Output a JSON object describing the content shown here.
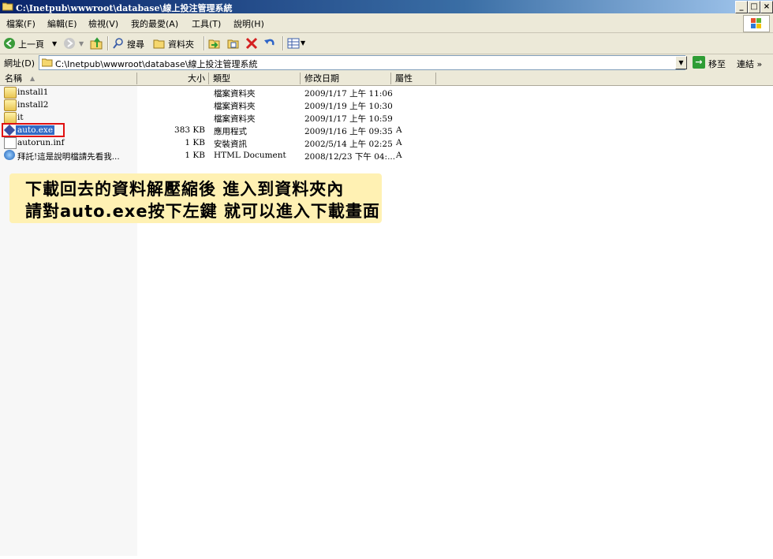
{
  "window": {
    "title": "C:\\Inetpub\\wwwroot\\database\\線上投注管理系統",
    "buttons": {
      "minimize": "_",
      "maximize": "□",
      "close": "×"
    }
  },
  "menu": [
    "檔案(F)",
    "編輯(E)",
    "檢視(V)",
    "我的最愛(A)",
    "工具(T)",
    "說明(H)"
  ],
  "toolbar": {
    "back_label": "上一頁",
    "search_label": "搜尋",
    "folders_label": "資料夾"
  },
  "address": {
    "label": "網址(D)",
    "path": "C:\\Inetpub\\wwwroot\\database\\線上投注管理系統",
    "go_label": "移至",
    "links_label": "連結"
  },
  "columns": [
    "名稱",
    "大小",
    "類型",
    "修改日期",
    "屬性"
  ],
  "files": [
    {
      "name": "install1",
      "size": "",
      "type": "檔案資料夾",
      "modified": "2009/1/17 上午 11:06",
      "attr": "",
      "icon": "folder-icon"
    },
    {
      "name": "install2",
      "size": "",
      "type": "檔案資料夾",
      "modified": "2009/1/19 上午 10:30",
      "attr": "",
      "icon": "folder-icon"
    },
    {
      "name": "it",
      "size": "",
      "type": "檔案資料夾",
      "modified": "2009/1/17 上午 10:59",
      "attr": "",
      "icon": "folder-icon"
    },
    {
      "name": "auto.exe",
      "size": "383 KB",
      "type": "應用程式",
      "modified": "2009/1/16 上午 09:35",
      "attr": "A",
      "icon": "application-icon"
    },
    {
      "name": "autorun.inf",
      "size": "1 KB",
      "type": "安裝資訊",
      "modified": "2002/5/14 上午 02:25",
      "attr": "A",
      "icon": "setup-info-icon"
    },
    {
      "name": "拜託!這是說明檔請先看我...",
      "size": "1 KB",
      "type": "HTML Document",
      "modified": "2008/12/23 下午 04:...",
      "attr": "A",
      "icon": "html-document-icon"
    }
  ],
  "callout": {
    "line1": "下載回去的資料解壓縮後  進入到資料夾內",
    "line2": "請對auto.exe按下左鍵  就可以進入下載畫面"
  },
  "colors": {
    "title_start": "#0a246a",
    "selection": "#316ac5",
    "highlight_box": "#e01010",
    "callout_bg": "#fff1b3"
  }
}
